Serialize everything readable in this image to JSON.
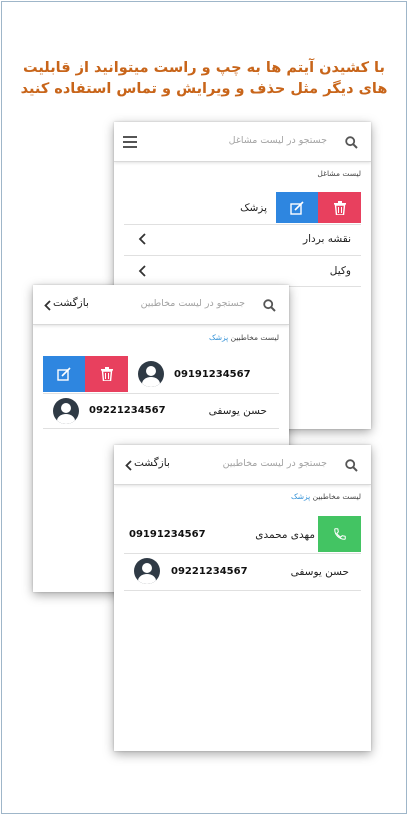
{
  "headline": {
    "line1": "با کشیدن آیتم ها به چپ و راست میتوانید از قابلیت",
    "line2": "های دیگر مثل حذف و ویرایش و تماس استفاده کنید"
  },
  "card1": {
    "search_placeholder": "جستجو در لیست مشاغل",
    "section_label": "لیست مشاغل",
    "items": [
      "پزشک",
      "نقشه بردار",
      "وکیل"
    ]
  },
  "card2": {
    "back_label": "بازگشت",
    "search_placeholder": "جستجو در لیست مخاطبین",
    "section_label": "لیست مخاطبین",
    "section_highlight": "پزشک",
    "contacts": [
      {
        "name": "",
        "phone": "09191234567"
      },
      {
        "name": "حسن یوسفی",
        "phone": "09221234567"
      }
    ]
  },
  "card3": {
    "back_label": "بازگشت",
    "search_placeholder": "جستجو در لیست مخاطبین",
    "section_label": "لیست مخاطبین",
    "section_highlight": "پزشک",
    "contacts": [
      {
        "name": "مهدی محمدی",
        "phone": "09191234567"
      },
      {
        "name": "حسن یوسفی",
        "phone": "09221234567"
      }
    ]
  },
  "colors": {
    "accent_blue": "#2e86e0",
    "delete_red": "#e8405e",
    "call_green": "#43c463",
    "headline": "#c8651a"
  }
}
